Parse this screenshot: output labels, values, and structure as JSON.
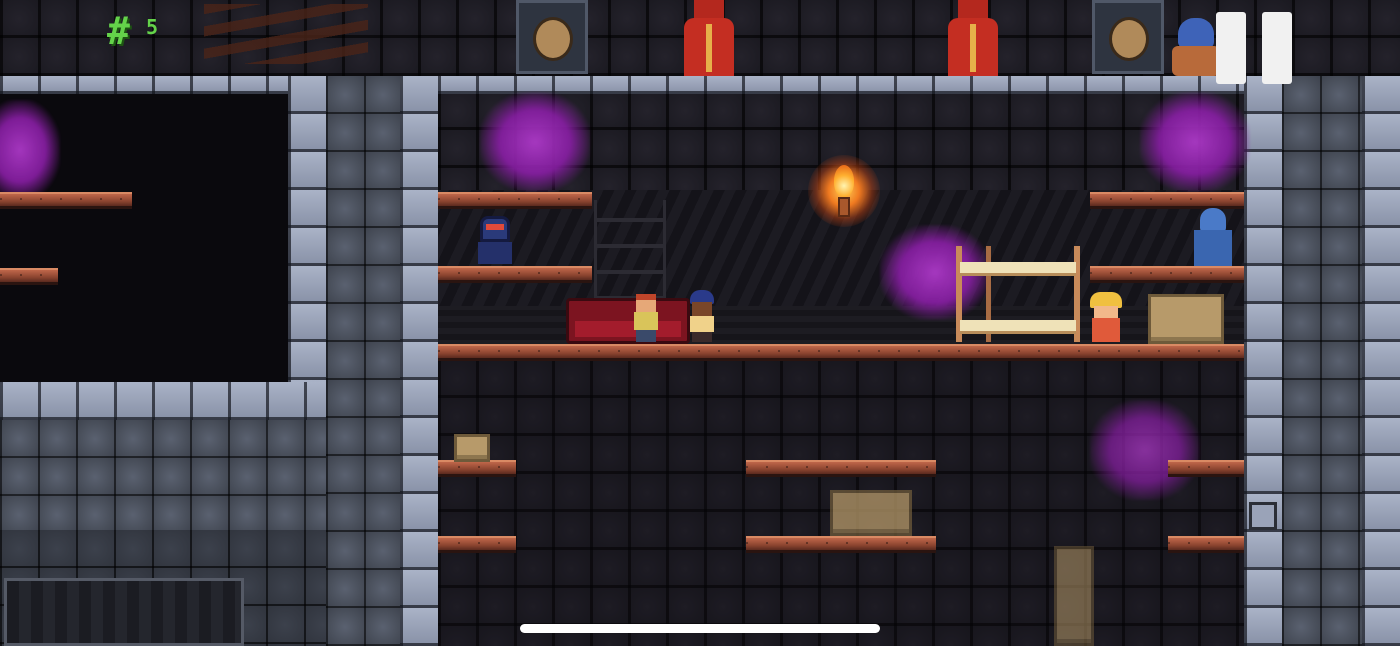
{
  "hud": {
    "counter_symbol": "#",
    "counter_value": "5",
    "counter_color": "#64d34a",
    "pause_icon": "pause-icon"
  },
  "scene": {
    "torch_icon": "flame-icon",
    "colors": {
      "plank": "#b35c40",
      "stone_light": "#98a1b6",
      "stone_dark": "#3a3f4a",
      "goo": "#a62fc2",
      "crate": "#b79a6a"
    }
  }
}
